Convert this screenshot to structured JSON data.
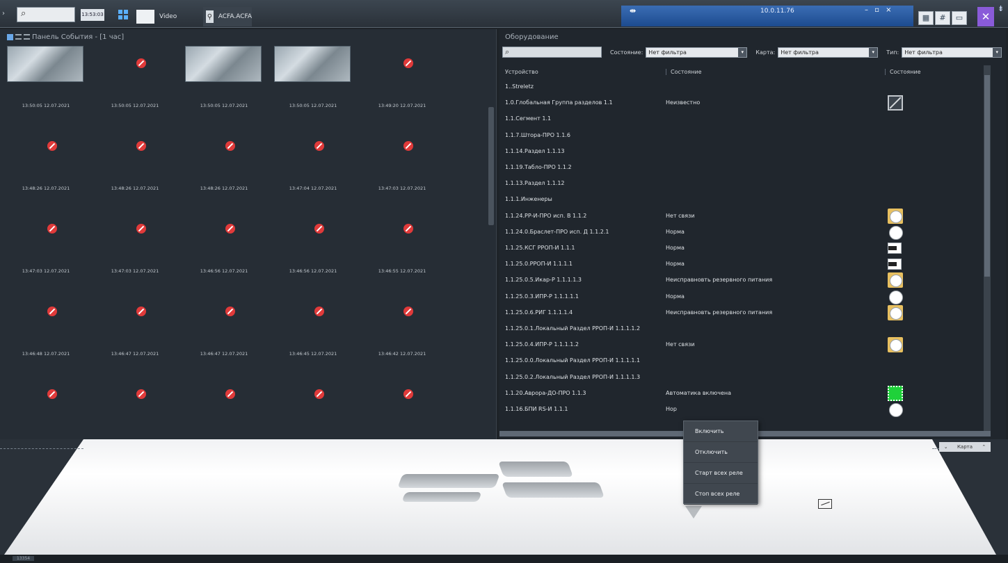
{
  "topbar": {
    "time": "13:53:03",
    "tabs": [
      {
        "label": "Video"
      },
      {
        "label": "ACFA.ACFA"
      }
    ],
    "server_ip": "10.0.11.76"
  },
  "events": {
    "title": "Панель События - [1 час]",
    "cells": [
      {
        "kind": "camera",
        "time": "13:50:05 12.07.2021"
      },
      {
        "kind": "none",
        "time": "13:50:05 12.07.2021"
      },
      {
        "kind": "camera",
        "time": "13:50:05 12.07.2021"
      },
      {
        "kind": "camera",
        "time": "13:50:05 12.07.2021"
      },
      {
        "kind": "none",
        "time": "13:49:20 12.07.2021"
      },
      {
        "kind": "none",
        "time": "13:48:26 12.07.2021"
      },
      {
        "kind": "none",
        "time": "13:48:26 12.07.2021"
      },
      {
        "kind": "none",
        "time": "13:48:26 12.07.2021"
      },
      {
        "kind": "none",
        "time": "13:47:04 12.07.2021"
      },
      {
        "kind": "none",
        "time": "13:47:03 12.07.2021"
      },
      {
        "kind": "none",
        "time": "13:47:03 12.07.2021"
      },
      {
        "kind": "none",
        "time": "13:47:03 12.07.2021"
      },
      {
        "kind": "none",
        "time": "13:46:56 12.07.2021"
      },
      {
        "kind": "none",
        "time": "13:46:56 12.07.2021"
      },
      {
        "kind": "none",
        "time": "13:46:55 12.07.2021"
      },
      {
        "kind": "none",
        "time": "13:46:48 12.07.2021"
      },
      {
        "kind": "none",
        "time": "13:46:47 12.07.2021"
      },
      {
        "kind": "none",
        "time": "13:46:47 12.07.2021"
      },
      {
        "kind": "none",
        "time": "13:46:45 12.07.2021"
      },
      {
        "kind": "none",
        "time": "13:46:42 12.07.2021"
      },
      {
        "kind": "none",
        "time": ""
      },
      {
        "kind": "none",
        "time": ""
      },
      {
        "kind": "none",
        "time": ""
      },
      {
        "kind": "none",
        "time": ""
      },
      {
        "kind": "none",
        "time": ""
      }
    ]
  },
  "equipment": {
    "title": "Оборудование",
    "filters": {
      "state_label": "Состояние:",
      "state_value": "Нет фильтра",
      "map_label": "Карта:",
      "map_value": "Нет фильтра",
      "type_label": "Тип:",
      "type_value": "Нет фильтра"
    },
    "columns": {
      "device": "Устройство",
      "state": "Состояние",
      "state_icon": "Состояние"
    },
    "rows": [
      {
        "device": "1..Streletz",
        "state": "",
        "icon": ""
      },
      {
        "device": "1.0.Глобальная Группа разделов 1.1",
        "state": "Неизвестно",
        "icon": "slash"
      },
      {
        "device": "1.1.Сегмент 1.1",
        "state": "",
        "icon": ""
      },
      {
        "device": "1.1.7.Штора-ПРО 1.1.6",
        "state": "",
        "icon": ""
      },
      {
        "device": "1.1.14.Раздел 1.1.13",
        "state": "",
        "icon": ""
      },
      {
        "device": "1.1.19.Табло-ПРО 1.1.2",
        "state": "",
        "icon": ""
      },
      {
        "device": "1.1.13.Раздел 1.1.12",
        "state": "",
        "icon": ""
      },
      {
        "device": "1.1.1.Инженеры",
        "state": "",
        "icon": ""
      },
      {
        "device": "1.1.24.РР-И-ПРО исп. В 1.1.2",
        "state": "Нет связи",
        "icon": "circle-y"
      },
      {
        "device": "1.1.24.0.Браслет-ПРО исп. Д 1.1.2.1",
        "state": "Норма",
        "icon": "circle-w"
      },
      {
        "device": "1.1.25.КСГ РРОП-И 1.1.1",
        "state": "Норма",
        "icon": "box"
      },
      {
        "device": "1.1.25.0.РРОП-И 1.1.1.1",
        "state": "Норма",
        "icon": "box"
      },
      {
        "device": "1.1.25.0.5.Икар-Р 1.1.1.1.3",
        "state": "Неисправновть резервного питания",
        "icon": "circle-y"
      },
      {
        "device": "1.1.25.0.3.ИПР-Р 1.1.1.1.1",
        "state": "Норма",
        "icon": "circle-w"
      },
      {
        "device": "1.1.25.0.6.РИГ 1.1.1.1.4",
        "state": "Неисправновть резервного питания",
        "icon": "circle-y"
      },
      {
        "device": "1.1.25.0.1.Локальный Раздел РРОП-И 1.1.1.1.2",
        "state": "",
        "icon": ""
      },
      {
        "device": "1.1.25.0.4.ИПР-Р 1.1.1.1.2",
        "state": "Нет связи",
        "icon": "circle-y"
      },
      {
        "device": "1.1.25.0.0.Локальный Раздел РРОП-И 1.1.1.1.1",
        "state": "",
        "icon": ""
      },
      {
        "device": "1.1.25.0.2.Локальный Раздел РРОП-И 1.1.1.1.3",
        "state": "",
        "icon": ""
      },
      {
        "device": "1.1.20.Аврора-ДО-ПРО 1.1.3",
        "state": "Автоматика включена",
        "icon": "green"
      },
      {
        "device": "1.1.16.БПИ RS-И 1.1.1",
        "state": "Нор",
        "icon": "circle-w"
      }
    ]
  },
  "map": {
    "button_label": "Карта"
  },
  "context_menu": {
    "items": [
      "Включить",
      "Отключить",
      "Старт всех реле",
      "Стоп всех реле"
    ]
  },
  "bottombar": {
    "tag": "13354"
  }
}
